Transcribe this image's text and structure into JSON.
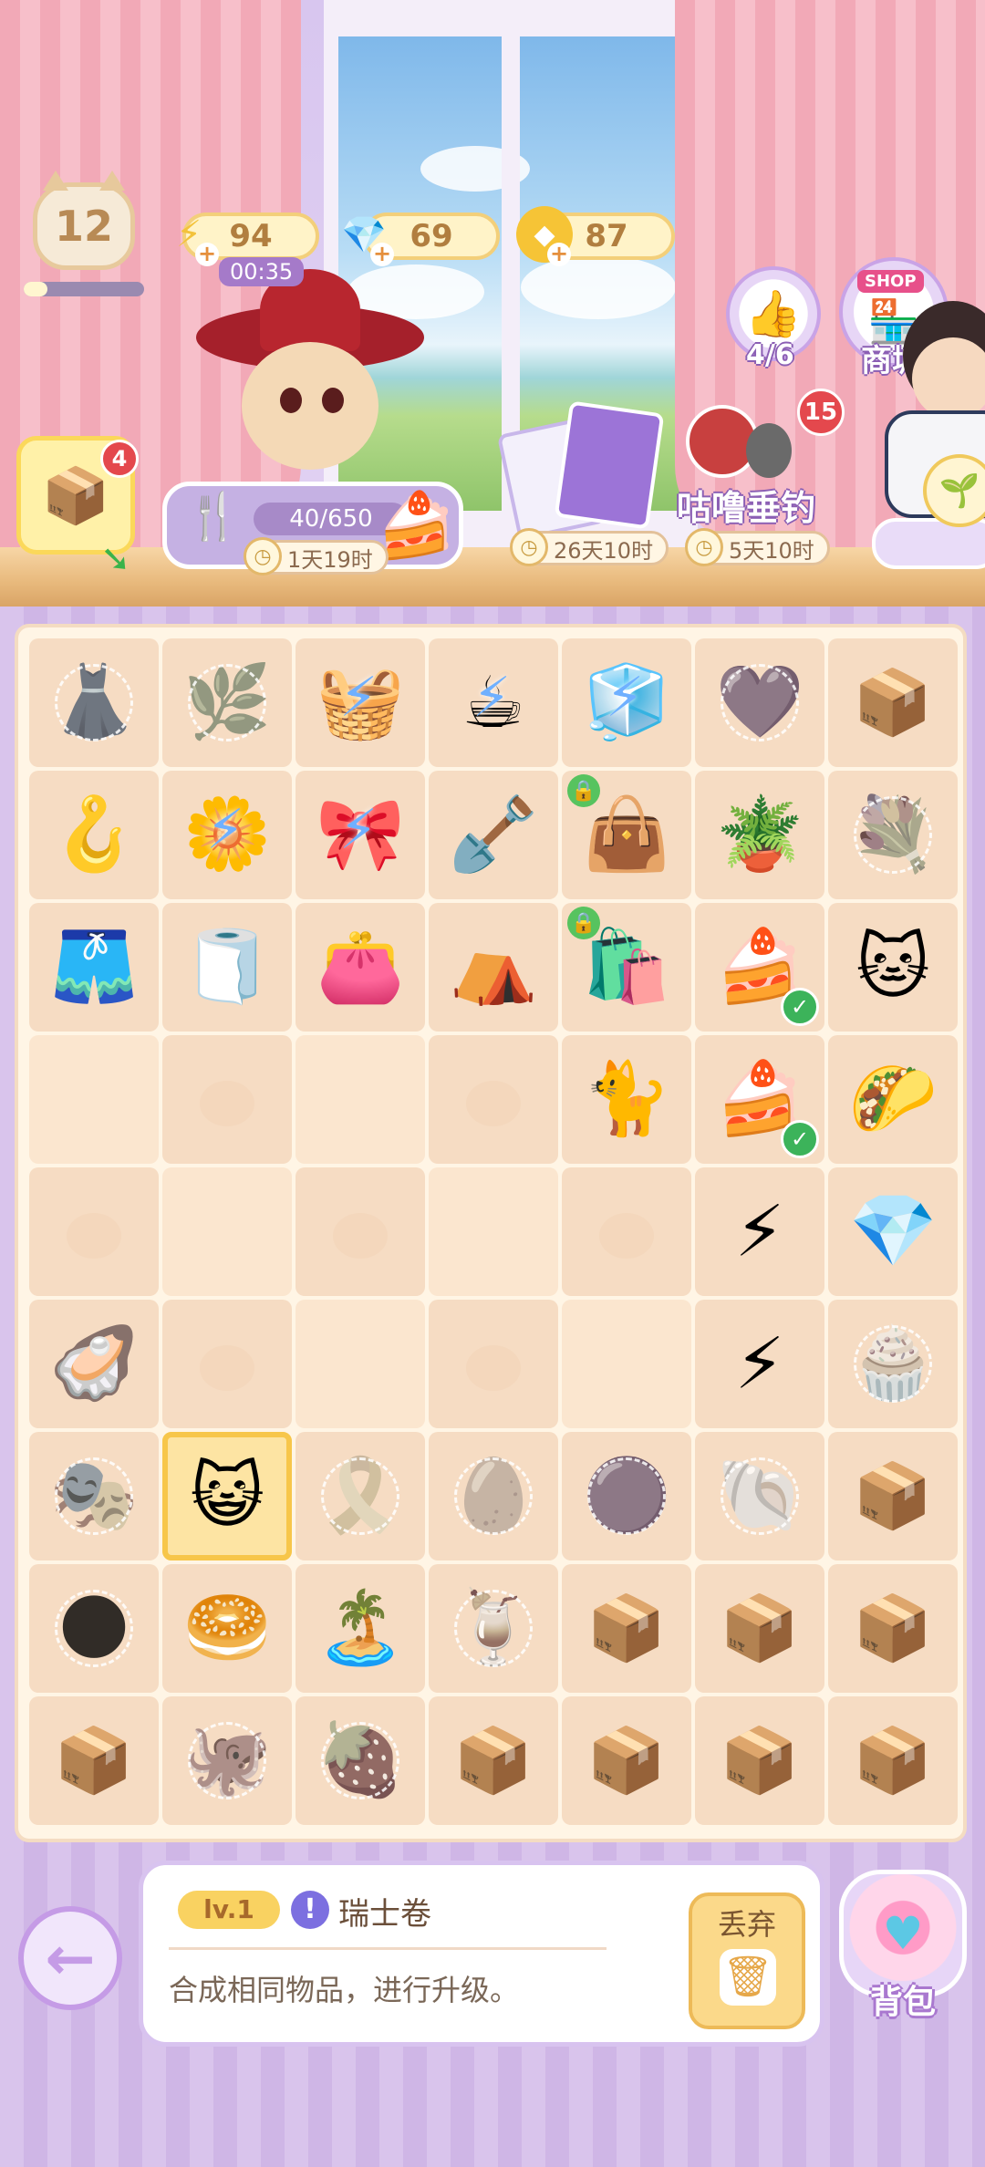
{
  "header": {
    "level": "12",
    "resources": {
      "energy": {
        "value": "94",
        "timer": "00:35"
      },
      "gems": {
        "value": "69"
      },
      "coins": {
        "value": "87"
      }
    },
    "likes_counter": "4/6",
    "shop": {
      "sign": "SHOP",
      "label": "商城"
    },
    "box_badge": "4"
  },
  "events": {
    "main_event": {
      "progress": "40/650",
      "timer": "1天19时"
    },
    "card_event": {
      "timer": "26天10时"
    },
    "fishing_event": {
      "title": "咕噜垂钓",
      "timer": "5天10时",
      "badge": "15"
    }
  },
  "board": {
    "rows": [
      [
        {
          "icon": "👗",
          "web": true
        },
        {
          "icon": "🌿",
          "web": true
        },
        {
          "icon": "🧺",
          "bolt": true
        },
        {
          "icon": "☕",
          "bolt": true
        },
        {
          "icon": "🧊",
          "bolt": true
        },
        {
          "icon": "💜",
          "web": true
        },
        {
          "icon": "📦",
          "box": true
        }
      ],
      [
        {
          "icon": "🪝"
        },
        {
          "icon": "🌼",
          "bolt": true
        },
        {
          "icon": "🎀",
          "bolt": true
        },
        {
          "icon": "🪏"
        },
        {
          "icon": "👜",
          "lock": true
        },
        {
          "icon": "🪴"
        },
        {
          "icon": "💐",
          "web": true
        }
      ],
      [
        {
          "icon": "🩳"
        },
        {
          "icon": "🧻"
        },
        {
          "icon": "👛"
        },
        {
          "icon": "⛺"
        },
        {
          "icon": "🛍️",
          "lock": true
        },
        {
          "icon": "🍰",
          "check": true
        },
        {
          "icon": "🐱"
        }
      ],
      [
        {
          "blank": true
        },
        {
          "empty": true
        },
        {
          "blank": true
        },
        {
          "empty": true
        },
        {
          "icon": "🐈"
        },
        {
          "icon": "🍰",
          "check": true
        },
        {
          "icon": "🌮"
        }
      ],
      [
        {
          "empty": true
        },
        {
          "blank": true
        },
        {
          "empty": true
        },
        {
          "blank": true
        },
        {
          "empty": true
        },
        {
          "icon": "⚡"
        },
        {
          "icon": "💎"
        }
      ],
      [
        {
          "icon": "🦪"
        },
        {
          "empty": true
        },
        {
          "blank": true
        },
        {
          "empty": true
        },
        {
          "blank": true
        },
        {
          "icon": "⚡"
        },
        {
          "icon": "🧁",
          "web": true
        }
      ],
      [
        {
          "icon": "🎭",
          "web": true
        },
        {
          "icon": "😺",
          "selected": true
        },
        {
          "icon": "🎗️",
          "web": true
        },
        {
          "icon": "🥚",
          "web": true
        },
        {
          "icon": "🟣",
          "web": true
        },
        {
          "icon": "🐚",
          "web": true
        },
        {
          "icon": "📦",
          "box": true
        }
      ],
      [
        {
          "icon": "🌑",
          "web": true
        },
        {
          "icon": "🥯"
        },
        {
          "icon": "🏝️"
        },
        {
          "icon": "🍹",
          "web": true
        },
        {
          "icon": "📦",
          "box": true
        },
        {
          "icon": "📦",
          "box": true
        },
        {
          "icon": "📦",
          "box": true
        }
      ],
      [
        {
          "icon": "📦",
          "box": true
        },
        {
          "icon": "🐙",
          "web": true
        },
        {
          "icon": "🍓",
          "web": true
        },
        {
          "icon": "📦",
          "box": true
        },
        {
          "icon": "📦",
          "box": true
        },
        {
          "icon": "📦",
          "box": true
        },
        {
          "icon": "📦",
          "box": true
        }
      ]
    ]
  },
  "info_panel": {
    "level": "lv.1",
    "item_name": "瑞士卷",
    "description": "合成相同物品，进行升级。",
    "discard_label": "丢弃"
  },
  "bag": {
    "label": "背包"
  }
}
